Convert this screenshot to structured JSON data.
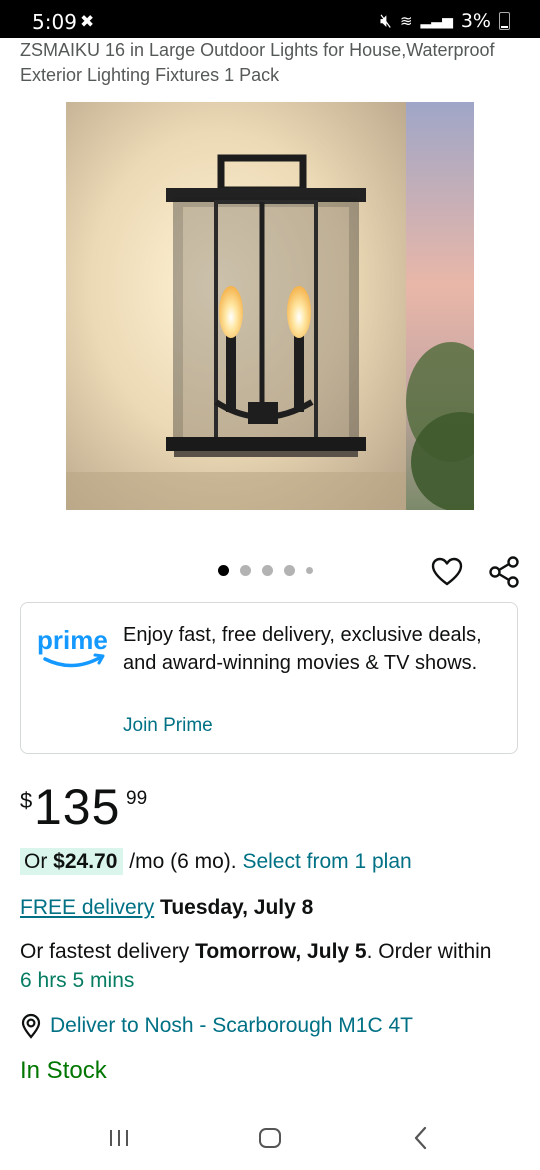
{
  "status_bar": {
    "time": "5:09",
    "notification_icon": "pinwheel-icon",
    "battery_percent": "3%",
    "icons": [
      "mute-icon",
      "wifi-icon",
      "signal-icon",
      "battery-icon"
    ]
  },
  "product": {
    "title": "ZSMAIKU 16 in Large Outdoor Lights for House,Waterproof Exterior Lighting Fixtures 1 Pack",
    "image_count": 5,
    "active_image_index": 0
  },
  "prime": {
    "logo_text": "prime",
    "message": "Enjoy fast, free delivery, exclusive deals, and award-winning movies & TV shows.",
    "join_label": "Join Prime"
  },
  "price": {
    "symbol": "$",
    "whole": "135",
    "fraction": "99"
  },
  "installment": {
    "prefix": "Or ",
    "amount": "$24.70",
    "terms": " /mo (6 mo). ",
    "select_label": "Select from 1 plan"
  },
  "delivery": {
    "free_label": "FREE delivery",
    "free_date": "Tuesday, July 8",
    "fastest_prefix": "Or fastest delivery ",
    "fastest_date": "Tomorrow, July 5",
    "order_within_prefix": ". Order within ",
    "countdown": "6 hrs 5 mins",
    "deliver_to": "Deliver to Nosh - Scarborough M1C 4T"
  },
  "stock_status": "In Stock",
  "colors": {
    "link": "#007185",
    "in_stock": "#007600",
    "countdown": "#067d62",
    "installment_highlight": "#d9f5ec",
    "prime_blue": "#1399ff"
  }
}
